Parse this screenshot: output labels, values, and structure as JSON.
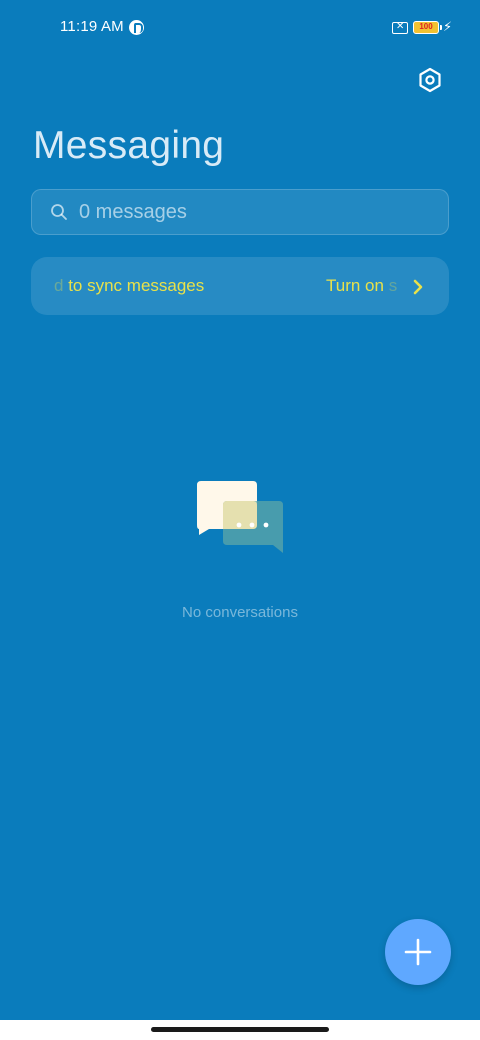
{
  "status_bar": {
    "time": "11:19 AM",
    "battery_level": "100",
    "icons": [
      "app-notification-icon",
      "sim-x-icon",
      "battery-icon",
      "charging-bolt-icon"
    ]
  },
  "header": {
    "title": "Messaging",
    "settings_icon": "settings-gear-icon"
  },
  "search": {
    "placeholder": "0 messages"
  },
  "sync_banner": {
    "leading_char": "d",
    "message": "to sync messages",
    "action": "Turn on",
    "action_trailing_char": "s"
  },
  "empty_state": {
    "illustration": "chat-bubbles-icon",
    "text": "No conversations"
  },
  "fab": {
    "icon": "plus-icon"
  },
  "colors": {
    "background": "#0a7cbc",
    "accent_yellow": "#e8e14a",
    "fab": "#5fa8ff"
  }
}
